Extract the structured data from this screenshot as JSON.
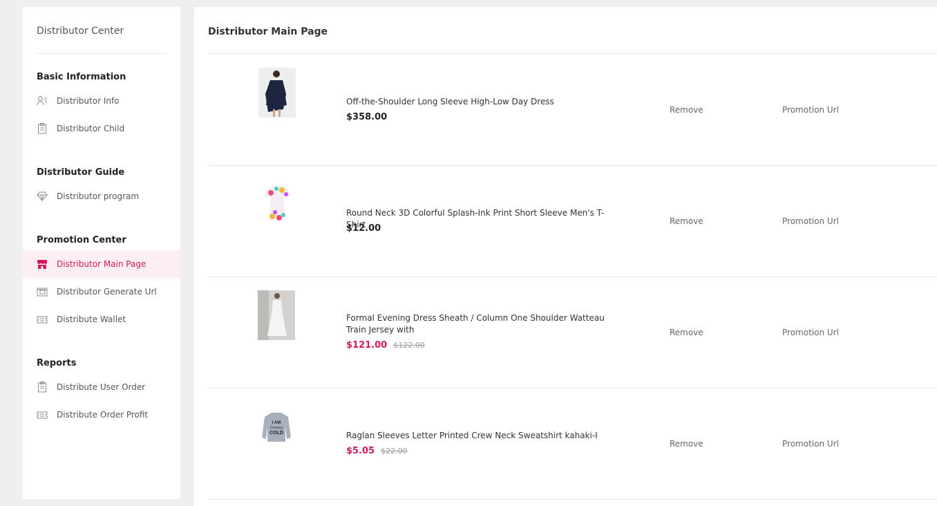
{
  "sidebar": {
    "title": "Distributor Center",
    "sections": {
      "basic": "Basic Information",
      "guide": "Distributor Guide",
      "promotion": "Promotion Center",
      "reports": "Reports"
    },
    "items": {
      "distributor_info": {
        "label": "Distributor Info",
        "icon": "user-list-icon"
      },
      "distributor_child": {
        "label": "Distributor Child",
        "icon": "clipboard-icon"
      },
      "distributor_program": {
        "label": "Distributor program",
        "icon": "diamond-icon"
      },
      "distributor_main_page": {
        "label": "Distributor Main Page",
        "icon": "shop-icon"
      },
      "distributor_generate_url": {
        "label": "Distributor Generate Url",
        "icon": "wallet-card-icon"
      },
      "distribute_wallet": {
        "label": "Distribute Wallet",
        "icon": "ticket-icon"
      },
      "distribute_user_order": {
        "label": "Distribute User Order",
        "icon": "clipboard-icon"
      },
      "distribute_order_profit": {
        "label": "Distribute Order Profit",
        "icon": "ticket-icon"
      }
    },
    "active_item": "distributor_main_page"
  },
  "main": {
    "title": "Distributor Main Page",
    "products": [
      {
        "name": "Off-the-Shoulder Long Sleeve High-Low Day Dress",
        "price": "$358.00",
        "old_price": "",
        "remove_label": "Remove",
        "promotion_label": "Promotion Url",
        "image": "navy dress"
      },
      {
        "name": "Round Neck 3D Colorful Splash-Ink Print Short Sleeve Men's T-Shirt",
        "price": "$12.00",
        "old_price": "",
        "remove_label": "Remove",
        "promotion_label": "Promotion Url",
        "image": "colorful t-shirt"
      },
      {
        "name": "Formal Evening Dress Sheath / Column One Shoulder Watteau Train Jersey with",
        "price": "$121.00",
        "old_price": "$122.00",
        "remove_label": "Remove",
        "promotion_label": "Promotion Url",
        "image": "white evening gown"
      },
      {
        "name": "Raglan Sleeves Letter Printed Crew Neck Sweatshirt kahaki-I",
        "price": "$5.05",
        "old_price": "$22.00",
        "remove_label": "Remove",
        "promotion_label": "Promotion Url",
        "image": "grey sweatshirt",
        "image_text": [
          "I AM",
          "Freaking",
          "COLD"
        ]
      }
    ]
  },
  "colors": {
    "accent": "#d6175f",
    "active_bg": "#fdeef2",
    "page_bg": "#efefef"
  }
}
